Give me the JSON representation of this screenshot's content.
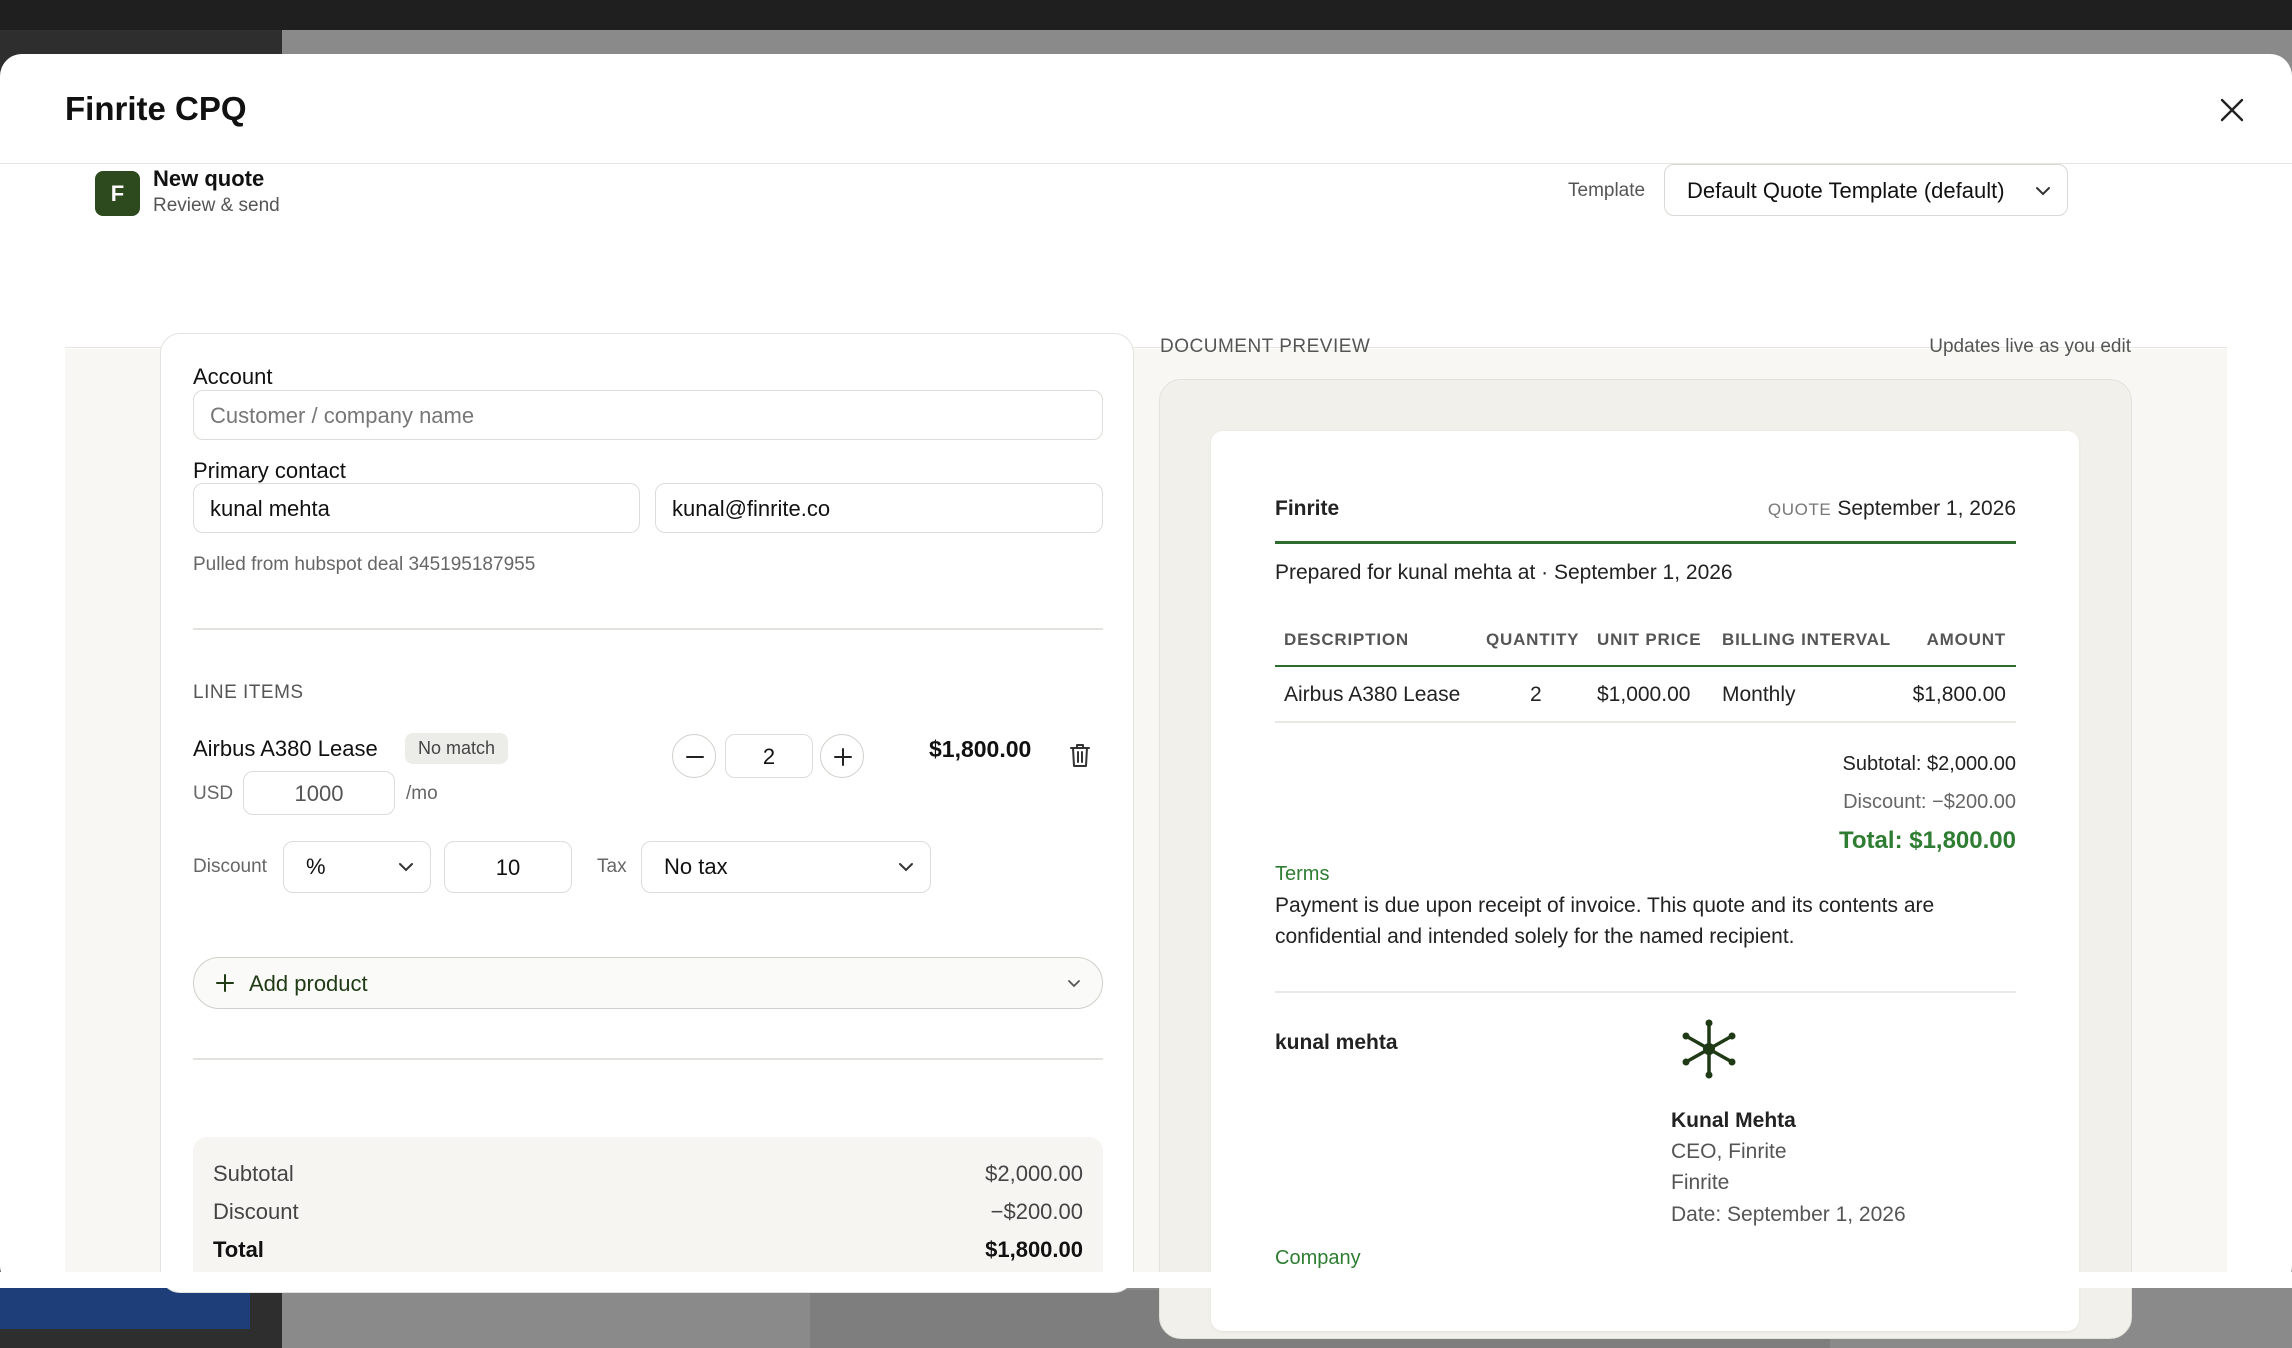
{
  "app": {
    "title": "Finrite CPQ"
  },
  "header": {
    "logo_letter": "F",
    "title": "New quote",
    "subtitle": "Review & send",
    "template_label": "Template",
    "template_value": "Default Quote Template (default)"
  },
  "account": {
    "label": "Account",
    "placeholder": "Customer / company name"
  },
  "contact": {
    "label": "Primary contact",
    "name": "kunal mehta",
    "email": "kunal@finrite.co",
    "note": "Pulled from hubspot deal 345195187955"
  },
  "line_items": {
    "caption": "LINE ITEMS",
    "items": [
      {
        "name": "Airbus A380 Lease",
        "badge": "No match",
        "currency": "USD",
        "unit_price": "1000",
        "period": "/mo",
        "quantity": "2",
        "amount": "$1,800.00",
        "discount_label": "Discount",
        "discount_type": "%",
        "discount_value": "10",
        "tax_label": "Tax",
        "tax_value": "No tax"
      }
    ],
    "add_product_label": "Add product"
  },
  "totals": {
    "subtotal_label": "Subtotal",
    "subtotal": "$2,000.00",
    "discount_label": "Discount",
    "discount": "−$200.00",
    "total_label": "Total",
    "total": "$1,800.00"
  },
  "preview": {
    "caption": "DOCUMENT PREVIEW",
    "live_note": "Updates live as you edit",
    "company": "Finrite",
    "quote_tag": "QUOTE",
    "quote_date": "September 1, 2026",
    "prepared_for": "Prepared for kunal mehta at · September 1, 2026",
    "table": {
      "headers": [
        "DESCRIPTION",
        "QUANTITY",
        "UNIT PRICE",
        "BILLING INTERVAL",
        "AMOUNT"
      ],
      "rows": [
        [
          "Airbus A380 Lease",
          "2",
          "$1,000.00",
          "Monthly",
          "$1,800.00"
        ]
      ]
    },
    "subtotal_line": "Subtotal: $2,000.00",
    "discount_line": "Discount: −$200.00",
    "total_line": "Total: $1,800.00",
    "terms_heading": "Terms",
    "terms_line1": "Payment is due upon receipt of invoice. This quote and its contents are",
    "terms_line2": "confidential and intended solely for the named recipient.",
    "customer_sign_name": "kunal mehta",
    "signer_name": "Kunal Mehta",
    "signer_title": "CEO, Finrite",
    "signer_company": "Finrite",
    "signer_date": "Date: September 1, 2026",
    "company_heading": "Company"
  },
  "colors": {
    "brand": "#2d4a1f",
    "accent_green": "#2e7d32"
  }
}
